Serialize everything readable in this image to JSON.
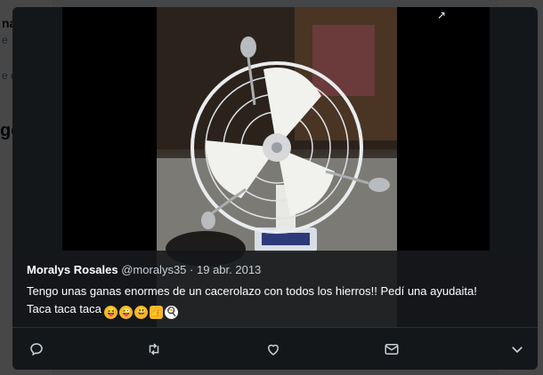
{
  "background": {
    "fragments": [
      "na",
      "e",
      "e d",
      "ge"
    ]
  },
  "tweet": {
    "author_name": "Moralys Rosales",
    "author_handle": "@moralys35",
    "separator": "·",
    "date": "19 abr. 2013",
    "text_line1": "Tengo unas ganas enormes de un cacerolazo con todos los hierros!! Pedí una ayudaita!",
    "text_line2": "Taca taca taca",
    "emojis": [
      {
        "icon": "squinting-tongue-face-emoji",
        "glyph": "😝",
        "color": "#f5b72a"
      },
      {
        "icon": "zany-face-emoji",
        "glyph": "😜",
        "color": "#f5b72a"
      },
      {
        "icon": "grinning-face-emoji",
        "glyph": "😃",
        "color": "#f5b72a"
      },
      {
        "icon": "thumbs-up-emoji",
        "glyph": "👍",
        "color": "#f5b72a"
      },
      {
        "icon": "egg-emoji",
        "glyph": "🍳",
        "color": "#ffffff"
      }
    ]
  },
  "media": {
    "expand_icon": "expand-icon",
    "glyph": "↗"
  },
  "actions": [
    {
      "name": "reply-icon"
    },
    {
      "name": "retweet-icon"
    },
    {
      "name": "like-icon"
    },
    {
      "name": "direct-message-icon"
    },
    {
      "name": "more-chevron-icon"
    }
  ],
  "colors": {
    "modal_bg": "#14171a",
    "text": "#ffffff",
    "muted": "#c9d1d8"
  }
}
